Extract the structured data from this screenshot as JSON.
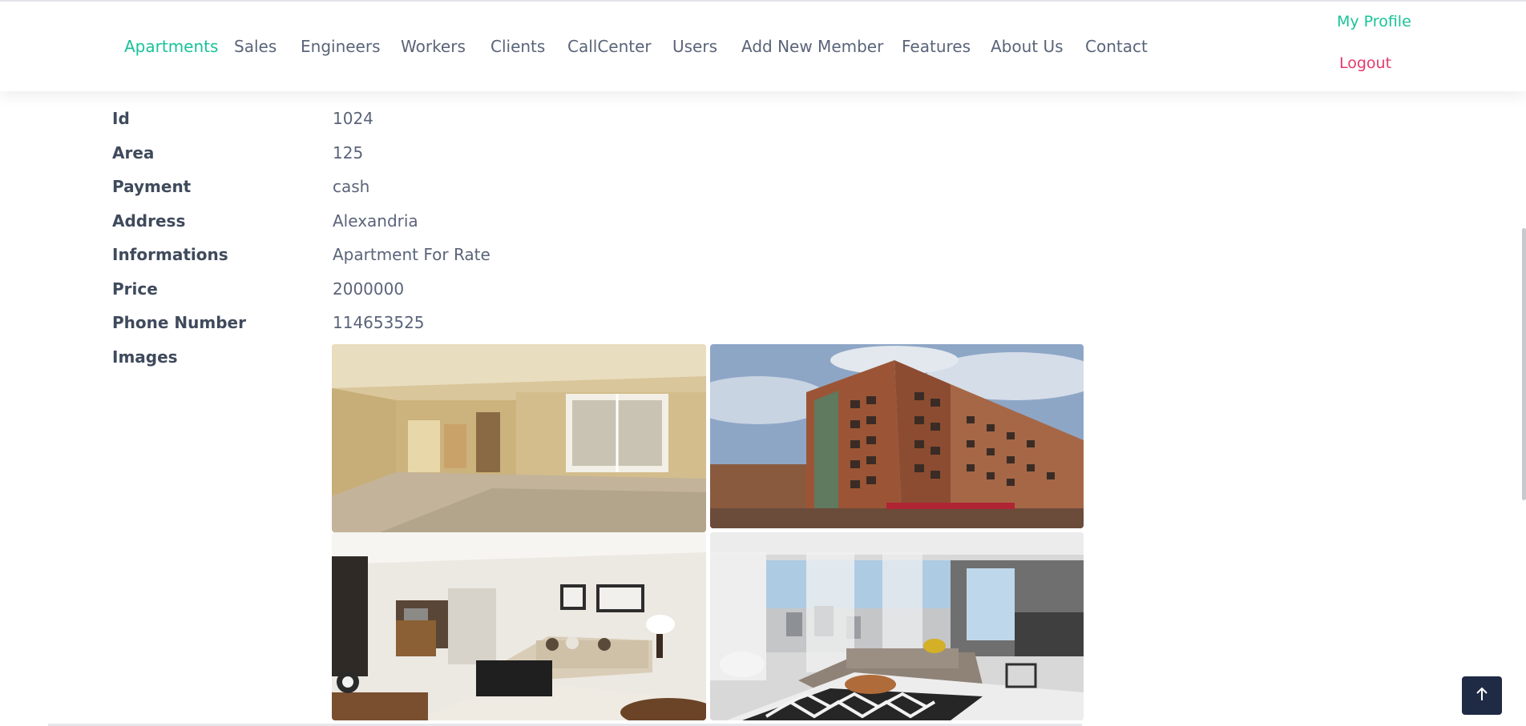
{
  "nav": {
    "items": [
      {
        "label": "Apartments",
        "active": true
      },
      {
        "label": "Sales",
        "active": false
      },
      {
        "label": "Engineers",
        "active": false
      },
      {
        "label": "Workers",
        "active": false
      },
      {
        "label": "Clients",
        "active": false
      },
      {
        "label": "CallCenter",
        "active": false
      },
      {
        "label": "Users",
        "active": false
      },
      {
        "label": "Add New Member",
        "active": false
      },
      {
        "label": "Features",
        "active": false
      },
      {
        "label": "About Us",
        "active": false
      },
      {
        "label": "Contact",
        "active": false
      }
    ],
    "profile_label": "My Profile",
    "logout_label": "Logout",
    "accent_color": "#19c29a",
    "logout_color": "#e6396b"
  },
  "details": [
    {
      "label": "Id",
      "value": "1024"
    },
    {
      "label": "Area",
      "value": "125"
    },
    {
      "label": "Payment",
      "value": "cash"
    },
    {
      "label": "Address",
      "value": "Alexandria"
    },
    {
      "label": "Informations",
      "value": "Apartment For Rate"
    },
    {
      "label": "Price",
      "value": "2000000"
    },
    {
      "label": "Phone Number",
      "value": "114653525"
    },
    {
      "label": "Images",
      "value": ""
    }
  ],
  "images": [
    {
      "subject": "empty-living-room"
    },
    {
      "subject": "apartment-building-exterior"
    },
    {
      "subject": "furnished-living-room"
    },
    {
      "subject": "modern-lounge-with-view"
    }
  ],
  "back_to_top_icon": "arrow-up-icon"
}
